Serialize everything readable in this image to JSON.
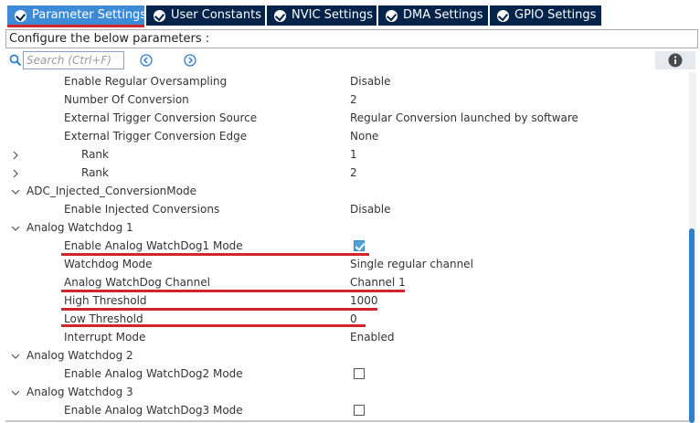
{
  "tabs": [
    {
      "label": "Parameter Settings",
      "active": true
    },
    {
      "label": "User Constants",
      "active": false
    },
    {
      "label": "NVIC Settings",
      "active": false
    },
    {
      "label": "DMA Settings",
      "active": false
    },
    {
      "label": "GPIO Settings",
      "active": false
    }
  ],
  "config_bar": {
    "text": "Configure the below parameters :"
  },
  "toolbar": {
    "search_placeholder": "Search (Ctrl+F)",
    "icons": [
      "search-icon",
      "back-icon",
      "forward-icon",
      "info-icon"
    ]
  },
  "colors": {
    "tab_bg": "#03234b",
    "tab_active": "#3d8bd6",
    "annotation_red": "#d0262b",
    "checkbox_checked": "#4aa3df",
    "scroll_thumb": "#2f7fd0"
  },
  "rows": [
    {
      "label": "Enable Regular Oversampling",
      "value": "Disable"
    },
    {
      "label": "Number Of Conversion",
      "value": "2"
    },
    {
      "label": "External Trigger Conversion Source",
      "value": "Regular Conversion launched by software"
    },
    {
      "label": "External Trigger Conversion Edge",
      "value": "None"
    },
    {
      "label": "Rank",
      "value": "1"
    },
    {
      "label": "Rank",
      "value": "2"
    },
    {
      "label": "ADC_Injected_ConversionMode",
      "value": ""
    },
    {
      "label": "Enable Injected Conversions",
      "value": "Disable"
    },
    {
      "label": "Analog Watchdog 1",
      "value": ""
    },
    {
      "label": "Enable Analog WatchDog1 Mode",
      "value": "",
      "checked": true
    },
    {
      "label": "Watchdog Mode",
      "value": "Single regular channel"
    },
    {
      "label": "Analog WatchDog Channel",
      "value": "Channel 1"
    },
    {
      "label": "High Threshold",
      "value": "1000"
    },
    {
      "label": "Low Threshold",
      "value": "0"
    },
    {
      "label": "Interrupt Mode",
      "value": "Enabled"
    },
    {
      "label": "Analog Watchdog 2",
      "value": ""
    },
    {
      "label": "Enable Analog WatchDog2 Mode",
      "value": "",
      "checked": false
    },
    {
      "label": "Analog Watchdog 3",
      "value": ""
    },
    {
      "label": "Enable Analog WatchDog3 Mode",
      "value": "",
      "checked": false
    }
  ]
}
